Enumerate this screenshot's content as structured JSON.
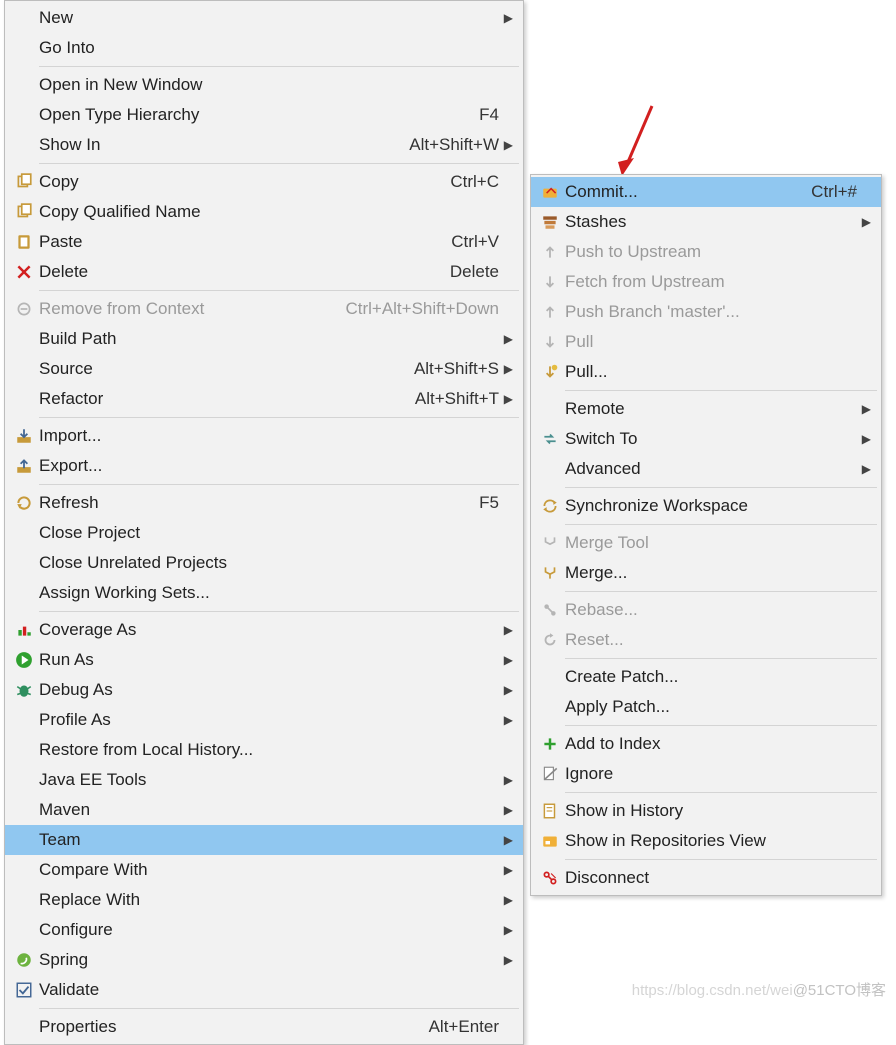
{
  "main_menu": [
    {
      "label": "New",
      "submenu": true
    },
    {
      "label": "Go Into"
    },
    "---",
    {
      "label": "Open in New Window"
    },
    {
      "label": "Open Type Hierarchy",
      "shortcut": "F4"
    },
    {
      "label": "Show In",
      "shortcut": "Alt+Shift+W",
      "submenu": true
    },
    "---",
    {
      "label": "Copy",
      "shortcut": "Ctrl+C",
      "icon": "copy-icon"
    },
    {
      "label": "Copy Qualified Name",
      "icon": "copy-qname-icon"
    },
    {
      "label": "Paste",
      "shortcut": "Ctrl+V",
      "icon": "paste-icon"
    },
    {
      "label": "Delete",
      "shortcut": "Delete",
      "icon": "delete-icon"
    },
    "---",
    {
      "label": "Remove from Context",
      "shortcut": "Ctrl+Alt+Shift+Down",
      "icon": "remove-context-icon",
      "disabled": true
    },
    {
      "label": "Build Path",
      "submenu": true
    },
    {
      "label": "Source",
      "shortcut": "Alt+Shift+S",
      "submenu": true
    },
    {
      "label": "Refactor",
      "shortcut": "Alt+Shift+T",
      "submenu": true
    },
    "---",
    {
      "label": "Import...",
      "icon": "import-icon"
    },
    {
      "label": "Export...",
      "icon": "export-icon"
    },
    "---",
    {
      "label": "Refresh",
      "shortcut": "F5",
      "icon": "refresh-icon"
    },
    {
      "label": "Close Project"
    },
    {
      "label": "Close Unrelated Projects"
    },
    {
      "label": "Assign Working Sets..."
    },
    "---",
    {
      "label": "Coverage As",
      "icon": "coverage-icon",
      "submenu": true
    },
    {
      "label": "Run As",
      "icon": "run-icon",
      "submenu": true
    },
    {
      "label": "Debug As",
      "icon": "debug-icon",
      "submenu": true
    },
    {
      "label": "Profile As",
      "submenu": true
    },
    {
      "label": "Restore from Local History..."
    },
    {
      "label": "Java EE Tools",
      "submenu": true
    },
    {
      "label": "Maven",
      "submenu": true
    },
    {
      "label": "Team",
      "submenu": true,
      "selected": true
    },
    {
      "label": "Compare With",
      "submenu": true
    },
    {
      "label": "Replace With",
      "submenu": true
    },
    {
      "label": "Configure",
      "submenu": true
    },
    {
      "label": "Spring",
      "icon": "spring-icon",
      "submenu": true
    },
    {
      "label": "Validate",
      "icon": "validate-icon"
    },
    "---",
    {
      "label": "Properties",
      "shortcut": "Alt+Enter"
    }
  ],
  "sub_menu": [
    {
      "label": "Commit...",
      "shortcut": "Ctrl+#",
      "icon": "commit-icon",
      "selected": true
    },
    {
      "label": "Stashes",
      "icon": "stashes-icon",
      "submenu": true
    },
    {
      "label": "Push to Upstream",
      "icon": "push-icon",
      "disabled": true
    },
    {
      "label": "Fetch from Upstream",
      "icon": "fetch-icon",
      "disabled": true
    },
    {
      "label": "Push Branch 'master'...",
      "icon": "push-branch-icon",
      "disabled": true
    },
    {
      "label": "Pull",
      "icon": "pull-icon-1",
      "disabled": true
    },
    {
      "label": "Pull...",
      "icon": "pull-icon-2"
    },
    "---",
    {
      "label": "Remote",
      "submenu": true
    },
    {
      "label": "Switch To",
      "icon": "switch-to-icon",
      "submenu": true
    },
    {
      "label": "Advanced",
      "submenu": true
    },
    "---",
    {
      "label": "Synchronize Workspace",
      "icon": "sync-workspace-icon"
    },
    "---",
    {
      "label": "Merge Tool",
      "icon": "merge-tool-icon",
      "disabled": true
    },
    {
      "label": "Merge...",
      "icon": "merge-icon"
    },
    "---",
    {
      "label": "Rebase...",
      "icon": "rebase-icon",
      "disabled": true
    },
    {
      "label": "Reset...",
      "icon": "reset-icon",
      "disabled": true
    },
    "---",
    {
      "label": "Create Patch..."
    },
    {
      "label": "Apply Patch..."
    },
    "---",
    {
      "label": "Add to Index",
      "icon": "add-index-icon"
    },
    {
      "label": "Ignore",
      "icon": "ignore-icon"
    },
    "---",
    {
      "label": "Show in History",
      "icon": "history-icon"
    },
    {
      "label": "Show in Repositories View",
      "icon": "repo-icon"
    },
    "---",
    {
      "label": "Disconnect",
      "icon": "disconnect-icon"
    }
  ],
  "watermark": {
    "left": "https://blog.csdn.net/wei",
    "right": "@51CTO博客"
  },
  "colors": {
    "selection_blue": "#90c7f0",
    "menu_bg": "#f2f2f2",
    "border": "#bdbdbd",
    "disabled_text": "#9a9a9a",
    "arrow_red": "#d21f1f"
  }
}
